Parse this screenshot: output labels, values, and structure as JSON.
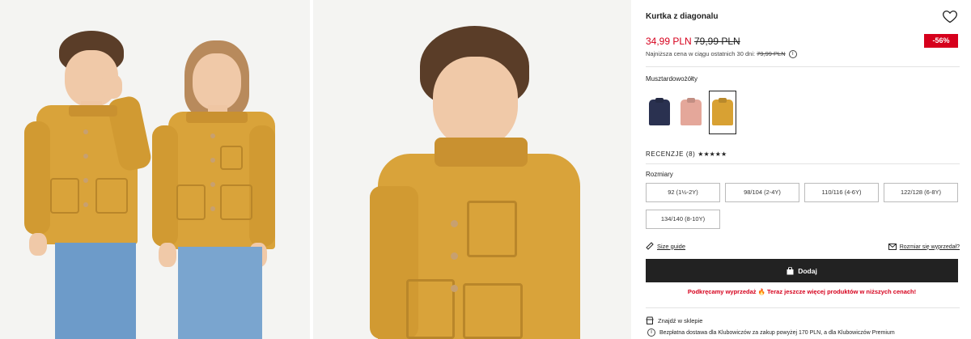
{
  "product": {
    "title": "Kurtka z diagonalu",
    "price_current": "34,99 PLN",
    "price_old": "79,99 PLN",
    "discount": "-56%",
    "lowest_price_label": "Najniższa cena w ciągu ostatnich 30 dni:",
    "lowest_price_value": "79,99 PLN"
  },
  "color": {
    "selected_name": "Musztardowożółty",
    "swatches": [
      {
        "name": "navy",
        "color": "#2a3150"
      },
      {
        "name": "pink",
        "color": "#e4a79a"
      },
      {
        "name": "mustard",
        "color": "#d8a133"
      }
    ]
  },
  "reviews": {
    "label": "RECENZJE (8)",
    "stars": "★★★★★"
  },
  "sizes": {
    "label": "Rozmiary",
    "options": [
      "92 (1½-2Y)",
      "98/104 (2-4Y)",
      "110/116 (4-6Y)",
      "122/128 (6-8Y)",
      "134/140 (8-10Y)"
    ]
  },
  "links": {
    "size_guide": "Size guide",
    "size_help": "Rozmiar się wyprzedał?"
  },
  "actions": {
    "add_label": "Dodaj"
  },
  "promo": {
    "text_before": "Podkręcamy wyprzedaż",
    "text_after": "Teraz jeszcze więcej produktów w niższych cenach!"
  },
  "store": {
    "find_label": "Znajdź w sklepie"
  },
  "delivery": {
    "text": "Bezpłatna dostawa dla Klubowiczów za zakup powyżej 170 PLN, a dla Klubowiczów Premium"
  }
}
